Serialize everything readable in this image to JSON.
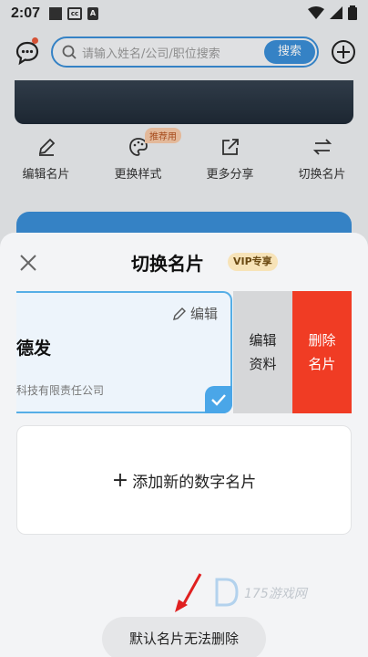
{
  "status_bar": {
    "time": "2:07",
    "cc_label": "cc"
  },
  "header": {
    "search_placeholder": "请输入姓名/公司/职位搜索",
    "search_button": "搜索"
  },
  "actions": [
    {
      "label": "编辑名片",
      "icon": "pencil-icon"
    },
    {
      "label": "更换样式",
      "icon": "palette-icon",
      "badge": "推荐用"
    },
    {
      "label": "更多分享",
      "icon": "share-icon"
    },
    {
      "label": "切换名片",
      "icon": "switch-icon"
    }
  ],
  "sheet": {
    "title": "切换名片",
    "vip_badge": "VIP专享",
    "card": {
      "edit_label": "编辑",
      "name": "德发",
      "company": "科技有限责任公司"
    },
    "edit_profile_line1": "编辑",
    "edit_profile_line2": "资料",
    "delete_line1": "删除",
    "delete_line2": "名片",
    "add_card_label": "添加新的数字名片",
    "add_card_plus": "+"
  },
  "toast": {
    "message": "默认名片无法删除"
  },
  "colors": {
    "accent": "#3a8ed6",
    "danger": "#f03c24",
    "selected_border": "#56aee6"
  }
}
